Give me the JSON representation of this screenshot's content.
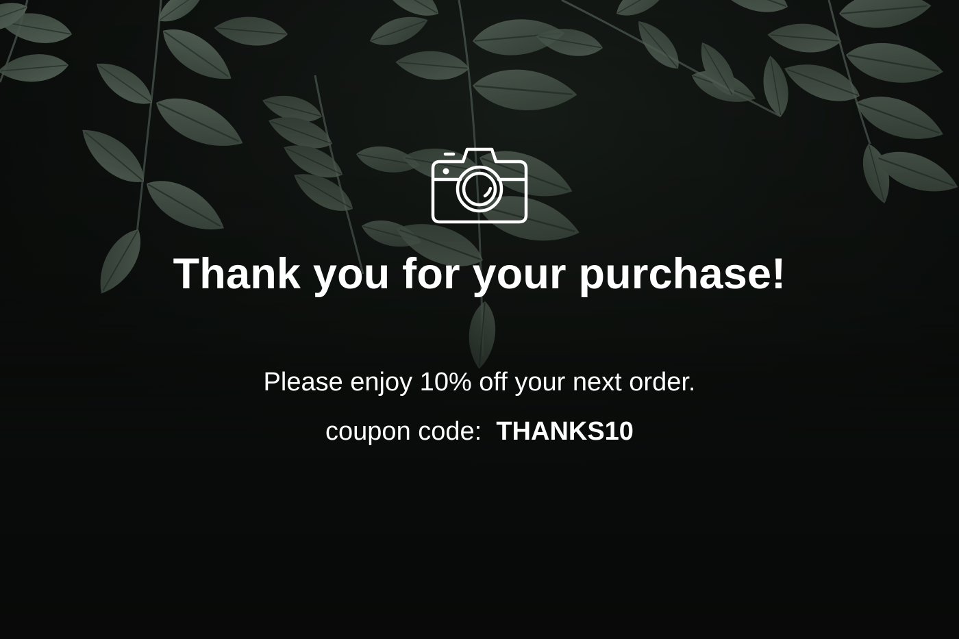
{
  "headline": "Thank you for your purchase!",
  "offer_text": "Please enjoy 10% off your next order.",
  "coupon": {
    "label": "coupon code:",
    "code": "THANKS10"
  },
  "icon": "camera-icon",
  "colors": {
    "text": "#ffffff",
    "background": "#0d100e",
    "leaf": "#5f6f63"
  }
}
